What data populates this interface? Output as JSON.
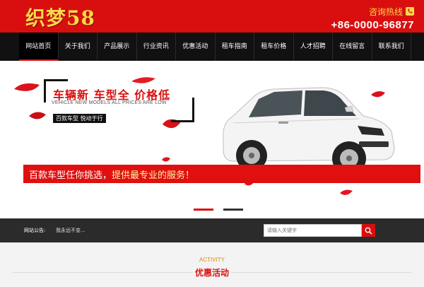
{
  "header": {
    "logo": "织梦58",
    "hotline_label": "咨询热线",
    "hotline_number": "+86-0000-96877",
    "bg_color": "#d90f0f",
    "accent_color": "#ffd84a"
  },
  "nav": {
    "items": [
      {
        "label": "网站首页",
        "active": true
      },
      {
        "label": "关于我们"
      },
      {
        "label": "产品展示"
      },
      {
        "label": "行业资讯"
      },
      {
        "label": "优惠活动"
      },
      {
        "label": "租车指南"
      },
      {
        "label": "租车价格"
      },
      {
        "label": "人才招聘"
      },
      {
        "label": "在线留言"
      },
      {
        "label": "联系我们"
      }
    ]
  },
  "banner": {
    "title": "车辆新 车型全 价格低",
    "subtitle": "VEHICLE NEW MODELS ALL PRICES ARE LOW",
    "tag": "百款车型 悦动于行",
    "slogan_part1": "百款车型任你挑选，",
    "slogan_part2": "提供最专业的服务！",
    "slide_count": 2,
    "active_slide": 1
  },
  "notice": {
    "label": "网站公告:",
    "text": "我永远不变..."
  },
  "search": {
    "placeholder": "请输入关键字",
    "icon": "search-icon"
  },
  "activity": {
    "title_en": "ACTIVITY",
    "title_cn": "优惠活动"
  }
}
